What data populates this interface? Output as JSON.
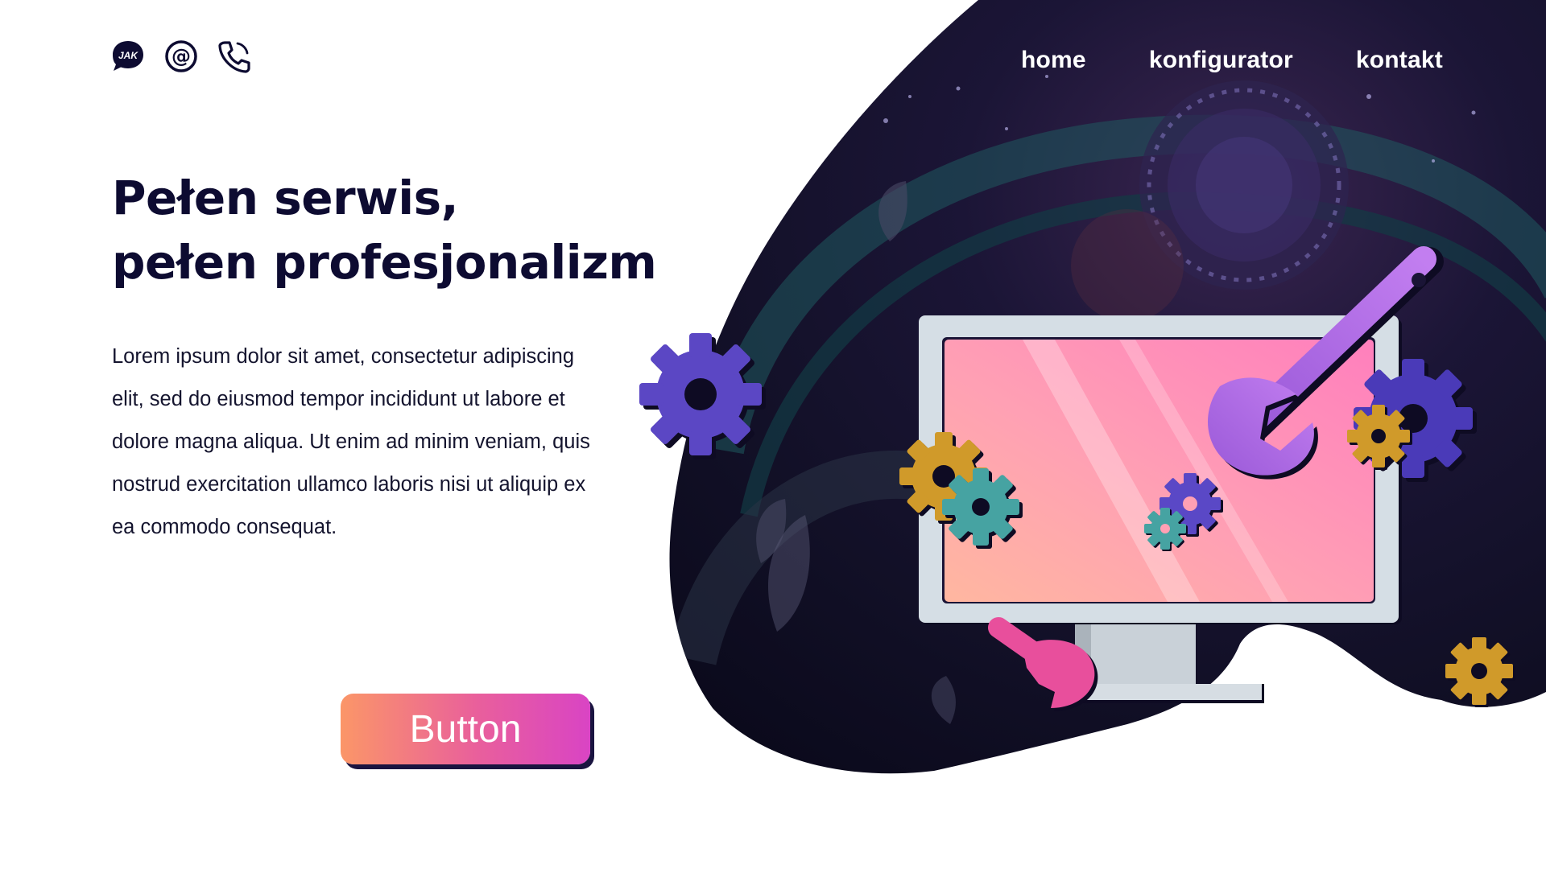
{
  "header": {
    "contact_icons": [
      {
        "icon": "chat-bubble-icon",
        "text": "JAK"
      },
      {
        "icon": "at-sign-icon"
      },
      {
        "icon": "phone-icon"
      }
    ],
    "nav": [
      {
        "label": "home"
      },
      {
        "label": "konfigurator"
      },
      {
        "label": "kontakt"
      }
    ]
  },
  "hero": {
    "title_line1": "Pełen serwis,",
    "title_line2": "pełen profesjonalizm",
    "body": "Lorem ipsum dolor sit amet, consectetur adipiscing elit, sed do eiusmod tempor incididunt ut labore et dolore magna aliqua. Ut enim ad minim veniam, quis nostrud exercitation ullamco laboris nisi ut aliquip ex ea commodo consequat.",
    "button_label": "Button"
  },
  "colors": {
    "text_dark": "#0d0b31",
    "blob_dark": "#0f0c23",
    "button_gradient_start": "#fb9668",
    "button_gradient_end": "#d944c4",
    "monitor_screen": "#ff8fb4",
    "wrench": "#a35fe0",
    "gear_purple": "#5a46c2",
    "gear_teal": "#45a3a2",
    "gear_gold": "#d09a2a"
  }
}
